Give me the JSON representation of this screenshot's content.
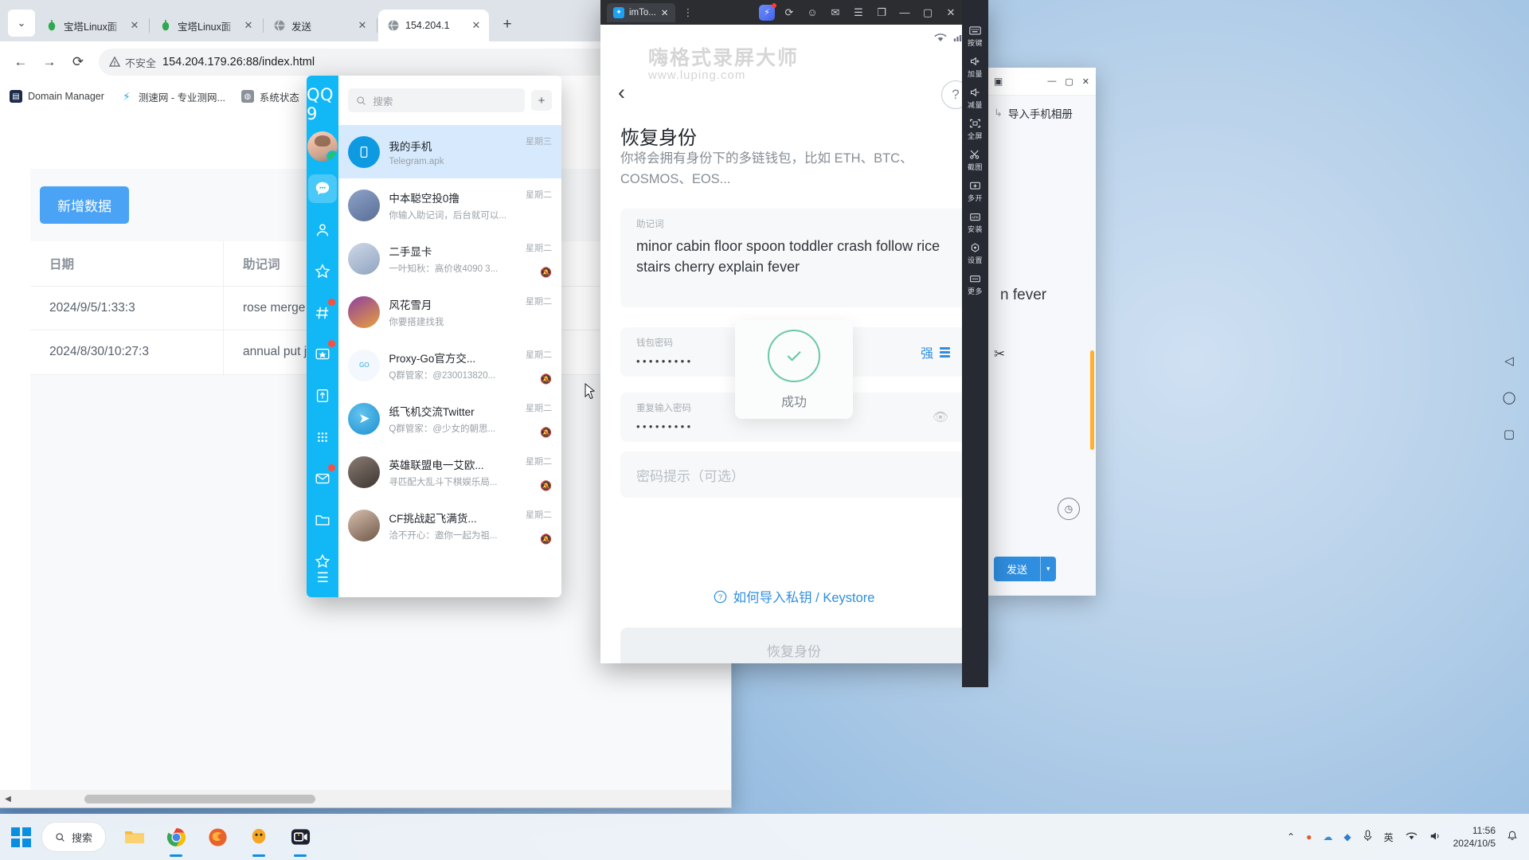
{
  "browser": {
    "tabs": [
      {
        "label": "宝塔Linux面",
        "icon": "bt-panel-icon",
        "active": false
      },
      {
        "label": "宝塔Linux面",
        "icon": "bt-panel-icon",
        "active": false
      },
      {
        "label": "发送",
        "icon": "globe-icon",
        "active": false
      },
      {
        "label": "154.204.1",
        "icon": "globe-icon",
        "active": true
      }
    ],
    "new_tab_label": "+",
    "window_controls": {
      "minimize": "—",
      "maximize": "▢",
      "close": "✕"
    },
    "nav": {
      "back": "←",
      "forward": "→",
      "reload": "⟳"
    },
    "omnibox": {
      "security_label": "不安全",
      "url": "154.204.179.26:88/index.html",
      "star": "☆"
    },
    "bookmarks": [
      {
        "label": "Domain Manager",
        "icon": "domain-manager-icon"
      },
      {
        "label": "测速网 - 专业测网...",
        "icon": "speedtest-icon"
      },
      {
        "label": "系统状态",
        "icon": "globe-icon"
      }
    ]
  },
  "page": {
    "add_button": "新增数据",
    "table": {
      "headers": [
        "日期",
        "助记词",
        ""
      ],
      "rows": [
        {
          "date": "2024/9/5/1:33:3",
          "mnemonic": "rose merge tornado m crease"
        },
        {
          "date": "2024/8/30/10:27:3",
          "mnemonic": "annual put jazz above"
        }
      ]
    }
  },
  "qq": {
    "logo": "QQ 9",
    "search_placeholder": "搜索",
    "add_label": "+",
    "rail_icons": [
      {
        "name": "chat-icon",
        "badge": false,
        "selected": true
      },
      {
        "name": "contacts-icon",
        "badge": false,
        "selected": false
      },
      {
        "name": "favorites-icon",
        "badge": false,
        "selected": false
      },
      {
        "name": "channels-icon",
        "badge": true,
        "selected": false
      },
      {
        "name": "qzone-icon",
        "badge": true,
        "selected": false
      },
      {
        "name": "files-icon",
        "badge": false,
        "selected": false
      },
      {
        "name": "apps-grid-icon",
        "badge": false,
        "selected": false
      },
      {
        "name": "mail-icon",
        "badge": true,
        "selected": false
      },
      {
        "name": "folder-icon",
        "badge": false,
        "selected": false
      },
      {
        "name": "star-icon",
        "badge": false,
        "selected": false
      }
    ],
    "menu_icon": "hamburger-icon",
    "chats": [
      {
        "name": "我的手机",
        "message": "Telegram.apk",
        "time": "星期三",
        "muted": false,
        "selected": true,
        "avatar": "phone-icon"
      },
      {
        "name": "中本聪空投0撸",
        "message": "你输入助记词，后台就可以...",
        "time": "星期二",
        "muted": false,
        "selected": false,
        "avatar": "cartoon-rabbit"
      },
      {
        "name": "二手显卡",
        "message": "一叶知秋：高价收4090 3...",
        "time": "星期二",
        "muted": true,
        "selected": false,
        "avatar": "anime-girl"
      },
      {
        "name": "风花雪月",
        "message": "你要搭建找我",
        "time": "星期二",
        "muted": false,
        "selected": false,
        "avatar": "dog-face"
      },
      {
        "name": "Proxy-Go官方交...",
        "message": "Q群管家：@230013820...",
        "time": "星期二",
        "muted": true,
        "selected": false,
        "avatar": "goproxy-logo"
      },
      {
        "name": "纸飞机交流Twitter",
        "message": "Q群管家：@少女的朝思...",
        "time": "星期二",
        "muted": true,
        "selected": false,
        "avatar": "telegram-logo"
      },
      {
        "name": "英雄联盟电一艾欧...",
        "message": "寻匹配大乱斗下棋娱乐局...",
        "time": "星期二",
        "muted": true,
        "selected": false,
        "avatar": "anime-portrait"
      },
      {
        "name": "CF挑战起飞满货...",
        "message": "洽不开心：邀你一起为祖...",
        "time": "星期二",
        "muted": true,
        "selected": false,
        "avatar": "anime-portrait2"
      }
    ]
  },
  "emulator": {
    "tab_title": "imTo...",
    "tab_close": "✕",
    "overflow_icon": "kebab-menu-icon",
    "titlebar_icons": [
      "boost-icon",
      "refresh-icon",
      "user-icon",
      "mail-icon",
      "menu-icon",
      "copy-icon"
    ],
    "window_controls": {
      "minimize": "—",
      "maximize": "▢",
      "close": "✕"
    },
    "collapse_icon": "chevron-right-icon",
    "watermark": {
      "title": "嗨格式录屏大师",
      "url": "www.luping.com"
    },
    "status": {
      "wifi": "wifi-icon",
      "signal": "signal-icon",
      "battery": "battery-icon"
    },
    "app": {
      "back_icon": "back-chevron-icon",
      "help_icon": "help-circle-icon",
      "title": "恢复身份",
      "subtitle": "你将会拥有身份下的多链钱包，比如 ETH、BTC、COSMOS、EOS...",
      "mnemonic_label": "助记词",
      "mnemonic_value": "minor cabin floor spoon toddler crash follow rice stairs cherry explain fever",
      "password_label": "钱包密码",
      "password_value": "•••••••••",
      "password_strength": "强",
      "repeat_label": "重复输入密码",
      "repeat_value": "•••••••••",
      "eye_icon": "eye-off-icon",
      "hint_placeholder": "密码提示（可选）",
      "help_link": "如何导入私钥 / Keystore",
      "help_link_icon": "question-circle-icon",
      "cta": "恢复身份"
    },
    "toast": {
      "icon": "check-circle-icon",
      "text": "成功"
    },
    "toolbar": [
      {
        "label": "按键",
        "icon": "keyboard-icon"
      },
      {
        "label": "加量",
        "icon": "volume-up-icon"
      },
      {
        "label": "减量",
        "icon": "volume-down-icon"
      },
      {
        "label": "全屏",
        "icon": "fullscreen-icon"
      },
      {
        "label": "截图",
        "icon": "scissors-icon"
      },
      {
        "label": "多开",
        "icon": "multi-instance-icon"
      },
      {
        "label": "安装",
        "icon": "apk-install-icon"
      },
      {
        "label": "设置",
        "icon": "settings-icon"
      },
      {
        "label": "更多",
        "icon": "more-icon"
      }
    ]
  },
  "window2": {
    "title": "导入手机相册",
    "header_icon": "import-icon",
    "arrow_icon": "arrow-right-icon",
    "controls": {
      "minimize": "—",
      "maximize": "▢",
      "close": "✕"
    },
    "snip_icon": "scissors-icon",
    "clock_icon": "clock-icon",
    "leak_text": "n fever",
    "send_label": "发送",
    "send_caret": "▾"
  },
  "desktop_icons": [
    {
      "name": "back-triangle-icon",
      "glyph": "◁"
    },
    {
      "name": "home-circle-icon",
      "glyph": "◯"
    },
    {
      "name": "recents-square-icon",
      "glyph": "▢"
    }
  ],
  "taskbar": {
    "start_icon": "windows-logo",
    "search_placeholder": "搜索",
    "search_icon": "search-icon",
    "apps": [
      {
        "name": "file-explorer-icon",
        "running": false
      },
      {
        "name": "chrome-icon",
        "running": true
      },
      {
        "name": "firefox-icon",
        "running": false
      },
      {
        "name": "qq-icon",
        "running": true
      },
      {
        "name": "screen-recorder-icon",
        "running": true
      }
    ],
    "tray": [
      {
        "name": "chevron-up-icon",
        "glyph": "⌃"
      },
      {
        "name": "tray-app-icon",
        "glyph": "●"
      },
      {
        "name": "tray-cloud-icon",
        "glyph": "☁"
      },
      {
        "name": "tray-shield-icon",
        "glyph": "◆"
      },
      {
        "name": "microphone-icon",
        "glyph": "🎤"
      },
      {
        "name": "ime-icon",
        "glyph": "英"
      },
      {
        "name": "wifi-icon",
        "glyph": "◗"
      },
      {
        "name": "volume-icon",
        "glyph": "◀"
      }
    ],
    "clock_time": "11:56",
    "clock_date": "2024/10/5",
    "notification_icon": "bell-icon"
  }
}
